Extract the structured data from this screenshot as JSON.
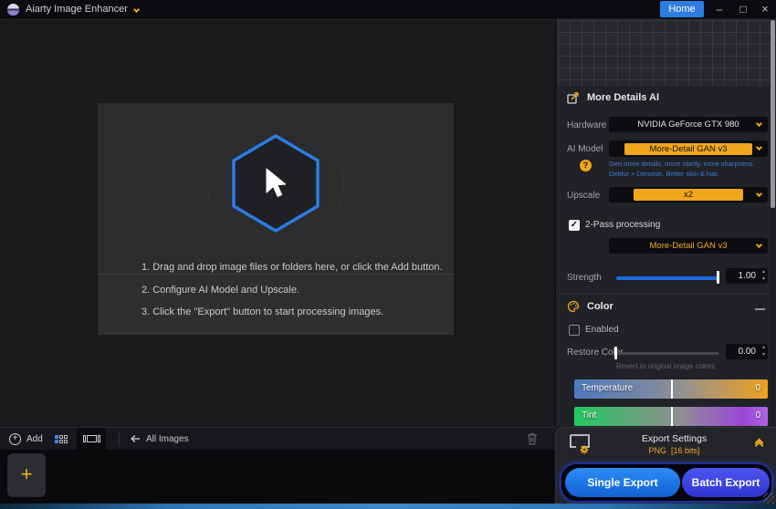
{
  "titlebar": {
    "app_name": "Aiarty Image Enhancer",
    "home_label": "Home"
  },
  "icons": {
    "check": "✓",
    "plus": "+",
    "spinner_up": "▴",
    "spinner_down": "▾",
    "minimize": "–",
    "maximize": "□",
    "close": "×",
    "help": "?"
  },
  "dropzone": {
    "instructions": [
      "1. Drag and drop image files or folders here, or click the Add button.",
      "2. Configure AI Model and Upscale.",
      "3. Click the \"Export\" button to start processing images."
    ]
  },
  "settings_panel": {
    "title": "More Details AI",
    "hardware_label": "Hardware",
    "hardware_value": "NVIDIA GeForce GTX 980",
    "ai_model_label": "AI Model",
    "ai_model_value": "More-Detail GAN v3",
    "ai_model_desc1": "Gen more details, more clarity, more sharpness.",
    "ai_model_desc2": "Deblur + Denoise. Better skin & hair.",
    "upscale_label": "Upscale",
    "upscale_value": "x2",
    "two_pass_label": "2-Pass processing",
    "two_pass_model_value": "More-Detail GAN v3",
    "strength_label": "Strength",
    "strength_value": "1.00",
    "color": {
      "title": "Color",
      "enabled_label": "Enabled",
      "restore_label": "Restore Color",
      "restore_value": "0.00",
      "restore_hint": "Revert to original image colors",
      "temperature_label": "Temperature",
      "temperature_value": "0",
      "tint_label": "Tint",
      "tint_value": "0"
    }
  },
  "bottom_bar": {
    "add_label": "Add",
    "filter_label": "All Images"
  },
  "export_panel": {
    "title": "Export Settings",
    "format": "PNG",
    "bits": "[16 bits]",
    "single_label": "Single Export",
    "batch_label": "Batch Export"
  },
  "colors": {
    "accent_yellow": "#f0a61d",
    "hexagon_blue": "#2b7de2",
    "strength_blue": "#1b6ae0",
    "single_export_blue": "#1d74e8",
    "batch_export_indigo": "#4046e0",
    "description_blue": "#4079d0",
    "home_button_blue": "#2d7de2"
  }
}
